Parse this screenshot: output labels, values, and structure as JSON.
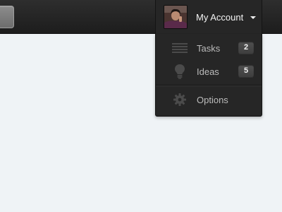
{
  "colors": {
    "page_background": "#eff3f6",
    "topbar": "#222222",
    "menu_background": "#262626",
    "menu_text": "#bcbcbc",
    "account_text": "#f4f4f4",
    "badge_background": "#474747"
  },
  "header": {
    "account": {
      "label": "My Account",
      "avatar_icon": "user-avatar",
      "caret_icon": "caret-down-icon"
    }
  },
  "account_menu": {
    "items": [
      {
        "label": "Tasks",
        "icon": "list-lines-icon",
        "badge": "2"
      },
      {
        "label": "Ideas",
        "icon": "lightbulb-icon",
        "badge": "5"
      }
    ],
    "options": {
      "label": "Options",
      "icon": "gear-icon"
    }
  }
}
